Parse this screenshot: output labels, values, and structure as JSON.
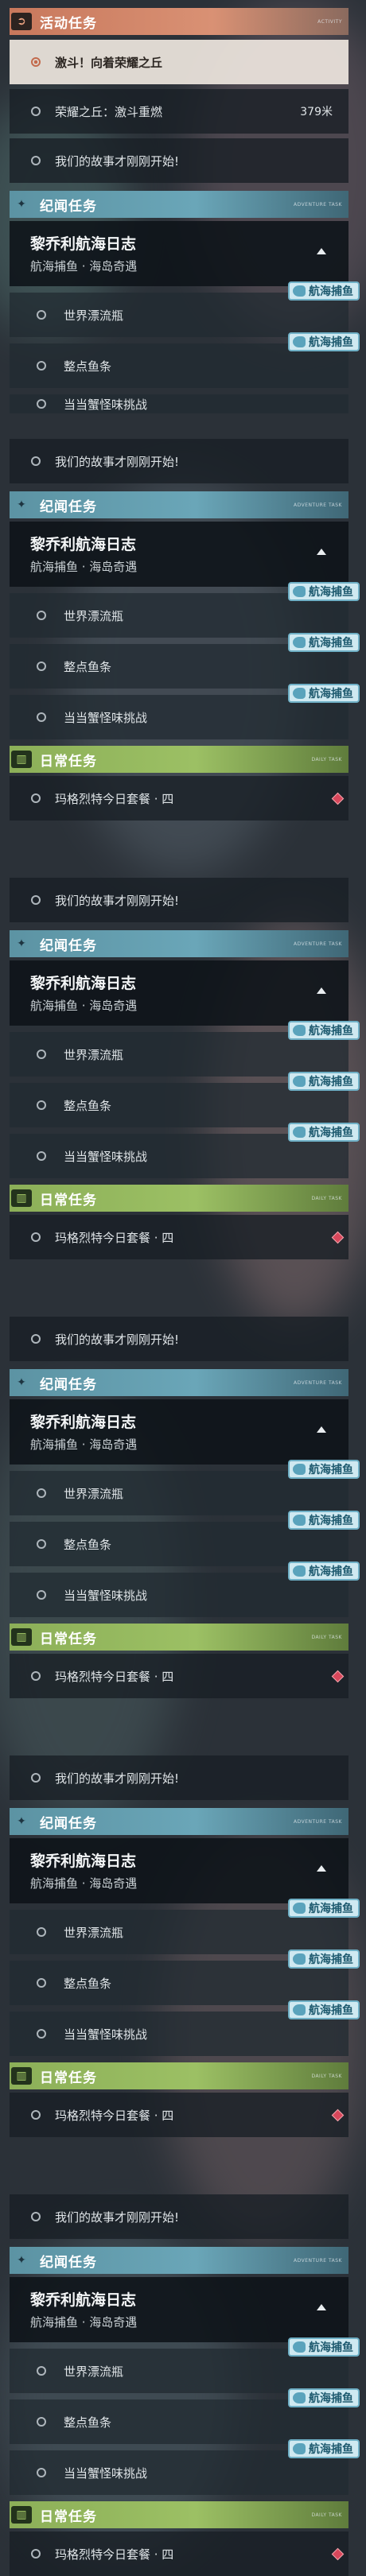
{
  "activity": {
    "header": "活动任务",
    "tag": "ACTIVITY",
    "rows": [
      {
        "label": "激斗！向着荣耀之丘"
      },
      {
        "label": "荣耀之丘：激斗重燃",
        "dist": "379米"
      },
      {
        "label": "我们的故事才刚刚开始!"
      }
    ]
  },
  "story": {
    "header": "纪闻任务",
    "tag": "ADVENTURE TASK",
    "card_title": "黎乔利航海日志",
    "card_sub": "航海捕鱼 · 海岛奇遇",
    "chip": "航海捕鱼",
    "items": [
      "世界漂流瓶",
      "整点鱼条",
      "当当蟹怪味挑战"
    ]
  },
  "daily": {
    "header": "日常任务",
    "tag": "DAILY TASK",
    "item": "玛格烈特今日套餐 · 四"
  },
  "shared_story_row": "我们的故事才刚刚开始!",
  "colors": {
    "activity": "#d08a6c",
    "story": "#6aa6b8",
    "daily": "#9cc064",
    "marker": "#d8475b"
  },
  "icons": {
    "activity": "quest-scroll-icon",
    "story": "compass-star-icon",
    "daily": "book-icon",
    "chip": "fish-icon",
    "expand": "chevron-up-icon"
  }
}
